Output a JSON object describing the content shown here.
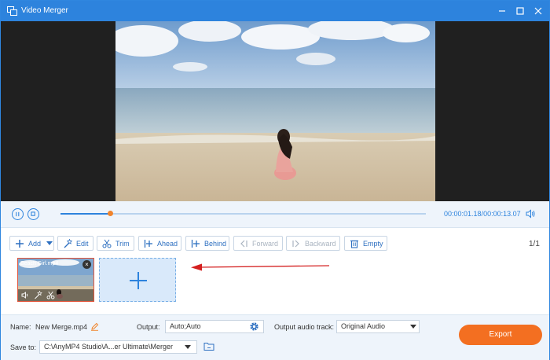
{
  "window": {
    "title": "Video Merger",
    "icons": [
      "app-icon",
      "minimize-icon",
      "maximize-icon",
      "close-icon"
    ]
  },
  "player": {
    "current_time": "00:00:01.18",
    "separator": "/",
    "total_time": "00:00:13.07",
    "progress": 0.137
  },
  "toolbar": {
    "add": "Add",
    "edit": "Edit",
    "trim": "Trim",
    "ahead": "Ahead",
    "behind": "Behind",
    "forward": "Forward",
    "backward": "Backward",
    "empty": "Empty",
    "page": "1/1"
  },
  "clips": [
    {
      "name": "Beach Girl.mp4"
    }
  ],
  "footer": {
    "name_label": "Name:",
    "name_value": "New Merge.mp4",
    "output_label": "Output:",
    "output_value": "Auto;Auto",
    "audio_label": "Output audio track:",
    "audio_value": "Original Audio",
    "save_label": "Save to:",
    "save_path": "C:\\AnyMP4 Studio\\A...er Ultimate\\Merger",
    "export_label": "Export"
  },
  "colors": {
    "accent": "#2d83dd",
    "export": "#f36f21",
    "arrow": "#d42020",
    "panel": "#eef4fb"
  }
}
